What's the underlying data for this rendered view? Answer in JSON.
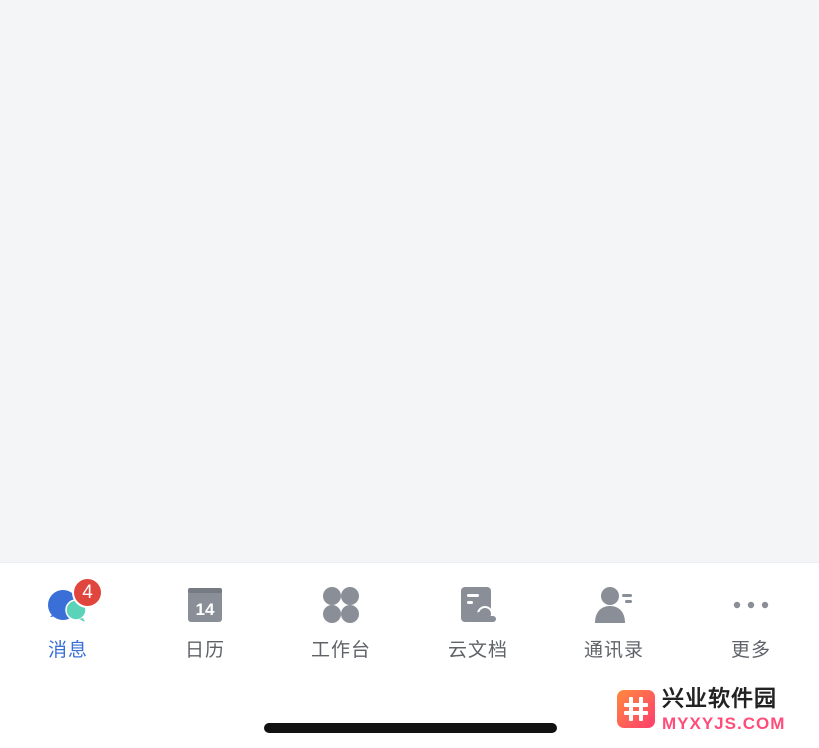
{
  "tabbar": {
    "tabs": [
      {
        "label": "消息",
        "icon": "chat-bubbles-icon",
        "badge": "4",
        "active": true
      },
      {
        "label": "日历",
        "icon": "calendar-icon",
        "date": "14",
        "active": false
      },
      {
        "label": "工作台",
        "icon": "workbench-grid-icon",
        "active": false
      },
      {
        "label": "云文档",
        "icon": "cloud-document-icon",
        "active": false
      },
      {
        "label": "通讯录",
        "icon": "contacts-icon",
        "active": false
      },
      {
        "label": "更多",
        "icon": "more-dots-icon",
        "active": false
      }
    ]
  },
  "watermark": {
    "title": "兴业软件园",
    "subtitle": "MYXYJS.COM"
  },
  "colors": {
    "background": "#f4f5f7",
    "active_label": "#3a6fd8",
    "inactive_label": "#5f6368",
    "icon_gray": "#8a8e96",
    "badge": "#e0463d",
    "chat_blue": "#3a6fd8",
    "chat_teal": "#5ad3b9"
  }
}
